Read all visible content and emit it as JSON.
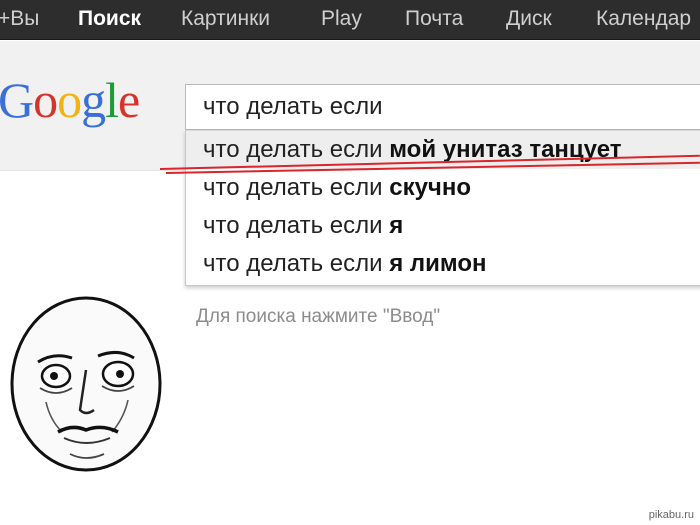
{
  "nav": {
    "items": [
      {
        "label": "+Вы",
        "active": false
      },
      {
        "label": "Поиск",
        "active": true
      },
      {
        "label": "Картинки",
        "active": false
      },
      {
        "label": "Play",
        "active": false
      },
      {
        "label": "Почта",
        "active": false
      },
      {
        "label": "Диск",
        "active": false
      },
      {
        "label": "Календар",
        "active": false
      }
    ]
  },
  "logo": {
    "letters": [
      "G",
      "o",
      "o",
      "g",
      "l",
      "e"
    ],
    "colors": [
      "#3a6fd8",
      "#d6342a",
      "#f2b20f",
      "#3a6fd8",
      "#1e9b38",
      "#d6342a"
    ]
  },
  "search": {
    "value": "что делать если"
  },
  "suggestions": [
    {
      "prefix": "что делать если ",
      "completion": "мой унитаз танцует"
    },
    {
      "prefix": "что делать если ",
      "completion": "скучно"
    },
    {
      "prefix": "что делать если ",
      "completion": "я"
    },
    {
      "prefix": "что делать если ",
      "completion": "я лимон"
    }
  ],
  "hint": "Для поиска нажмите \"Ввод\"",
  "watermark": "pikabu.ru",
  "colors": {
    "topbar": "#2d2d2d",
    "underline": "#d8262a"
  }
}
